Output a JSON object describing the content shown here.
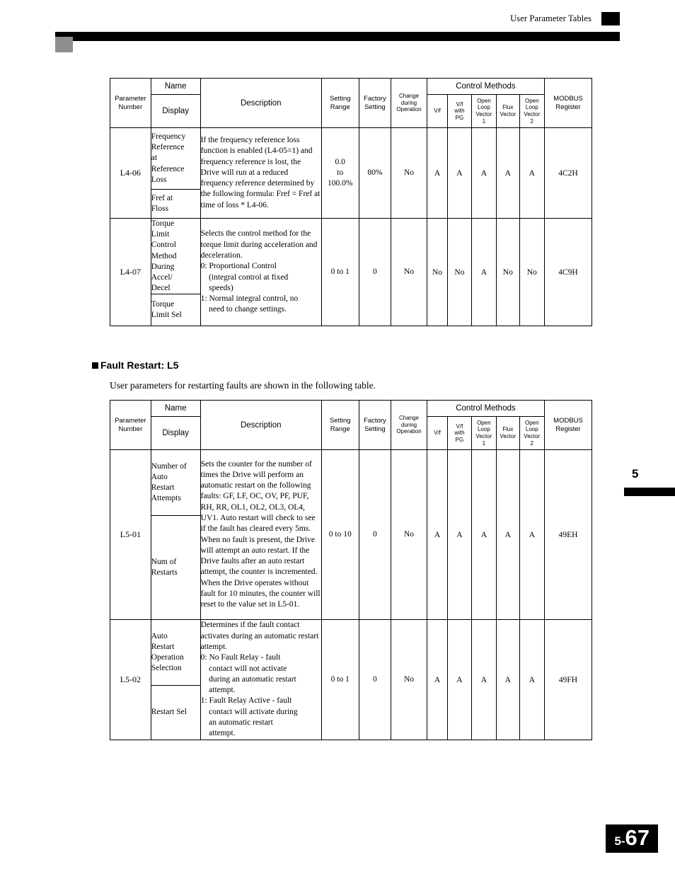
{
  "header": {
    "title": "User Parameter Tables"
  },
  "chapter": {
    "number": "5"
  },
  "footer": {
    "prefix": "5-",
    "page": "67"
  },
  "section": {
    "heading": "Fault Restart: L5",
    "intro": "User parameters for restarting faults are shown in the following table."
  },
  "table_headers": {
    "parameter_number": "Parameter\nNumber",
    "parameter_number_l1": "Parameter",
    "parameter_number_l2": "Number",
    "name": "Name",
    "display": "Display",
    "description": "Description",
    "setting_range_l1": "Setting",
    "setting_range_l2": "Range",
    "factory_setting_l1": "Factory",
    "factory_setting_l2": "Setting",
    "change_l1": "Change",
    "change_l2": "during",
    "change_l3": "Operation",
    "control_methods": "Control Methods",
    "vf": "V/f",
    "vf_pg_l1": "V/f",
    "vf_pg_l2": "with",
    "vf_pg_l3": "PG",
    "olv1_l1": "Open",
    "olv1_l2": "Loop",
    "olv1_l3": "Vector",
    "olv1_l4": "1",
    "flux_l1": "Flux",
    "flux_l2": "Vector",
    "olv2_l1": "Open",
    "olv2_l2": "Loop",
    "olv2_l3": "Vector",
    "olv2_l4": "2",
    "modbus_l1": "MODBUS",
    "modbus_l2": "Register"
  },
  "table1": {
    "rows": [
      {
        "number": "L4-06",
        "name": "Frequency\nReference\nat\nReference\nLoss",
        "display": "Fref at\nFloss",
        "description": "If the frequency reference loss function is enabled (L4-05=1) and frequency reference is lost, the Drive will run at a reduced frequency reference determined by the following formula: Fref = Fref at time of loss * L4-06.",
        "setting_range": "0.0\nto\n100.0%",
        "factory_setting": "80%",
        "change_during_operation": "No",
        "vf": "A",
        "vf_pg": "A",
        "olv1": "A",
        "flux": "A",
        "olv2": "A",
        "modbus": "4C2H"
      },
      {
        "number": "L4-07",
        "name": "Torque\nLimit\nControl\nMethod\nDuring\nAccel/\nDecel",
        "display": "Torque\nLimit Sel",
        "description": "Selects the control method for the torque limit during acceleration and deceleration.\n0: Proportional Control\n    (integral control at fixed\n    speeds)\n1: Normal integral control,  no\n    need to change settings.",
        "setting_range": "0 to 1",
        "factory_setting": "0",
        "change_during_operation": "No",
        "vf": "No",
        "vf_pg": "No",
        "olv1": "A",
        "flux": "No",
        "olv2": "No",
        "modbus": "4C9H"
      }
    ]
  },
  "table2": {
    "rows": [
      {
        "number": "L5-01",
        "name": "Number of\nAuto\nRestart\nAttempts",
        "display": "Num of\nRestarts",
        "description": "Sets the counter for the number of times the Drive will perform an automatic restart on the following faults: GF, LF, OC, OV, PF, PUF, RH, RR, OL1, OL2, OL3, OL4, UV1. Auto restart will check to see if the fault has cleared every 5ms. When no fault is present, the Drive will attempt an auto restart. If the Drive faults after an auto restart attempt, the counter is incremented. When the Drive operates without fault for 10 minutes, the counter will reset to the value set in L5-01.",
        "setting_range": "0 to 10",
        "factory_setting": "0",
        "change_during_operation": "No",
        "vf": "A",
        "vf_pg": "A",
        "olv1": "A",
        "flux": "A",
        "olv2": "A",
        "modbus": "49EH"
      },
      {
        "number": "L5-02",
        "name": "Auto\nRestart\nOperation\nSelection",
        "display": "Restart Sel",
        "description": "Determines if the fault contact activates during an automatic restart attempt.\n0: No Fault Relay - fault\n    contact will not activate\n    during an automatic restart\n    attempt.\n1: Fault Relay Active - fault\n    contact will activate during\n    an automatic restart\n    attempt.",
        "setting_range": "0 to 1",
        "factory_setting": "0",
        "change_during_operation": "No",
        "vf": "A",
        "vf_pg": "A",
        "olv1": "A",
        "flux": "A",
        "olv2": "A",
        "modbus": "49FH"
      }
    ]
  }
}
